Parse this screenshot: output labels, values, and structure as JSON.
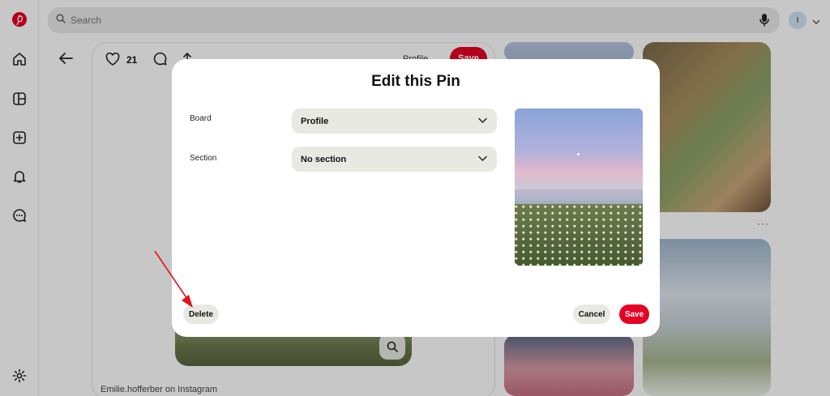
{
  "search": {
    "placeholder": "Search"
  },
  "avatar": {
    "initial": "I"
  },
  "pin": {
    "likes": "21",
    "board_label": "Profile",
    "save_label": "Save",
    "credit": "Emilie.hofferber on Instagram"
  },
  "modal": {
    "title": "Edit this Pin",
    "board_label": "Board",
    "board_value": "Profile",
    "section_label": "Section",
    "section_value": "No section",
    "delete_label": "Delete",
    "cancel_label": "Cancel",
    "save_label": "Save"
  },
  "tile_more": "···",
  "icons": [
    "pinterest-logo-icon",
    "home-icon",
    "boards-icon",
    "create-icon",
    "bell-icon",
    "messages-icon",
    "settings-icon",
    "search-icon",
    "mic-icon",
    "chevron-down-icon",
    "back-arrow-icon",
    "heart-icon",
    "comment-icon",
    "share-icon",
    "more-icon",
    "lens-icon"
  ],
  "colors": {
    "accent": "#e60023",
    "select_bg": "#e9e9e3",
    "annotation": "#e0141e"
  }
}
